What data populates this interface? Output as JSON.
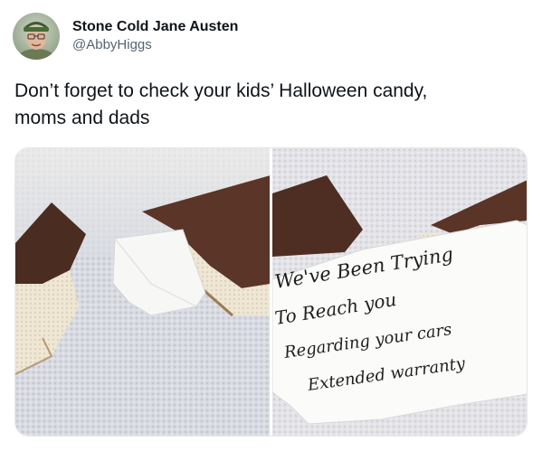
{
  "tweet": {
    "display_name": "Stone Cold Jane Austen",
    "handle": "@AbbyHiggs",
    "text": "Don’t forget to check your kids’ Halloween candy,\nmoms and dads"
  },
  "media": {
    "note_lines": [
      "We've Been Trying",
      "To Reach you",
      "Regarding your cars",
      "Extended warranty"
    ]
  },
  "icons": {
    "avatar": "user-photo"
  }
}
